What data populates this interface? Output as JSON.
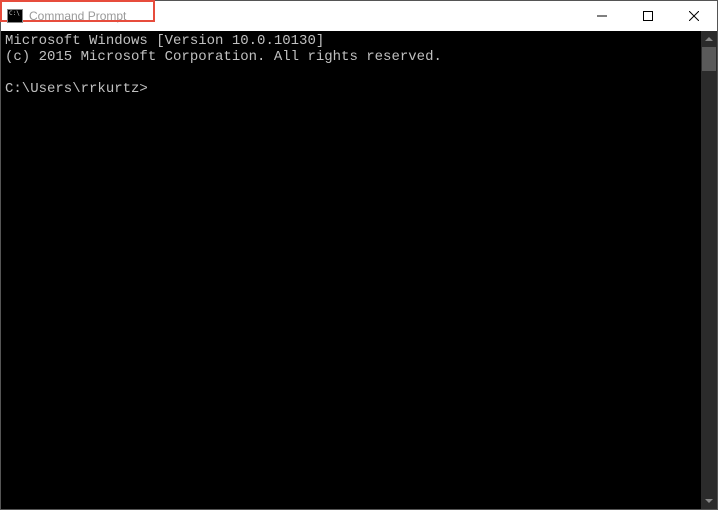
{
  "window": {
    "title": "Command Prompt"
  },
  "terminal": {
    "line1": "Microsoft Windows [Version 10.0.10130]",
    "line2": "(c) 2015 Microsoft Corporation. All rights reserved.",
    "prompt": "C:\\Users\\rrkurtz>"
  }
}
